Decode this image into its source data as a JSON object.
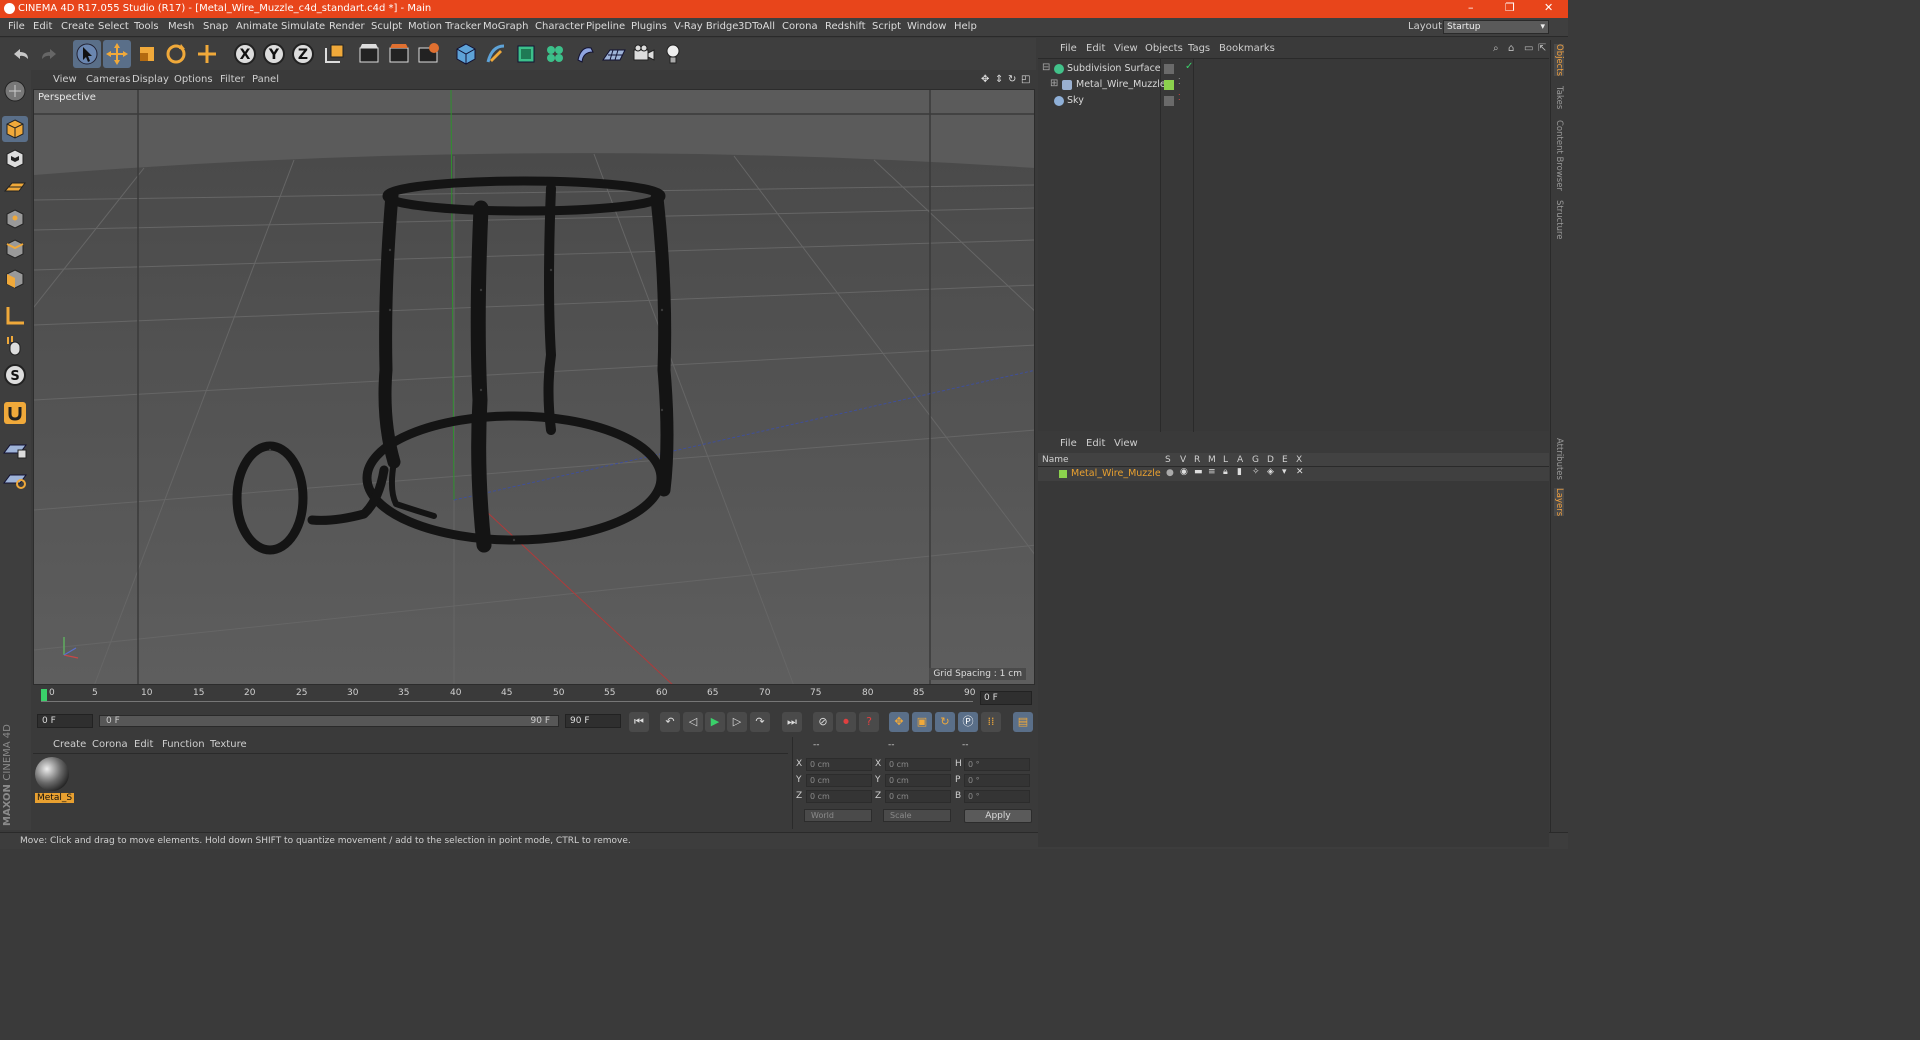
{
  "window": {
    "title": "CINEMA 4D R17.055 Studio (R17) - [Metal_Wire_Muzzle_c4d_standart.c4d *] - Main",
    "minimize": "–",
    "restore": "❐",
    "close": "✕"
  },
  "menu": [
    "File",
    "Edit",
    "Create",
    "Select",
    "Tools",
    "Mesh",
    "Snap",
    "Animate",
    "Simulate",
    "Render",
    "Sculpt",
    "Motion Tracker",
    "MoGraph",
    "Character",
    "Pipeline",
    "Plugins",
    "V-Ray Bridge",
    "3DToAll",
    "Corona",
    "Redshift",
    "Script",
    "Window",
    "Help"
  ],
  "layout": {
    "label": "Layout:",
    "value": "Startup"
  },
  "toolbar_icons": [
    "undo-icon",
    "redo-icon",
    "select-arrow-icon",
    "move-icon",
    "scale-icon",
    "rotate-icon",
    "last-tool-icon",
    "x-axis-icon",
    "y-axis-icon",
    "z-axis-icon",
    "coordinate-system-icon",
    "render-view-icon",
    "render-picture-viewer-icon",
    "render-settings-icon",
    "cube-icon",
    "pen-icon",
    "subdivision-icon",
    "cloner-icon",
    "deformer-icon",
    "floor-icon",
    "camera-icon",
    "light-icon"
  ],
  "viewport": {
    "menu": [
      "View",
      "Cameras",
      "Display",
      "Options",
      "Filter",
      "Panel"
    ],
    "camera_label": "Perspective",
    "grid_spacing": "Grid Spacing : 1 cm"
  },
  "timeline": {
    "ticks": [
      "0",
      "5",
      "10",
      "15",
      "20",
      "25",
      "30",
      "35",
      "40",
      "45",
      "50",
      "55",
      "60",
      "65",
      "70",
      "75",
      "80",
      "85",
      "90"
    ],
    "current_frame": "0 F"
  },
  "transport": {
    "start_field": "0 F",
    "slider_start": "0 F",
    "slider_end": "90 F",
    "end_field": "90 F"
  },
  "material_manager": {
    "menu": [
      "Create",
      "Corona",
      "Edit",
      "Function",
      "Texture"
    ],
    "material_name": "Metal_S"
  },
  "coordinates": {
    "header": [
      "--",
      "--",
      "--"
    ],
    "rows": [
      {
        "axis": "X",
        "pos": "0 cm",
        "size_axis": "X",
        "size": "0 cm",
        "rot_axis": "H",
        "rot": "0 °"
      },
      {
        "axis": "Y",
        "pos": "0 cm",
        "size_axis": "Y",
        "size": "0 cm",
        "rot_axis": "P",
        "rot": "0 °"
      },
      {
        "axis": "Z",
        "pos": "0 cm",
        "size_axis": "Z",
        "size": "0 cm",
        "rot_axis": "B",
        "rot": "0 °"
      }
    ],
    "coord_mode": "World",
    "size_mode": "Scale",
    "apply": "Apply"
  },
  "brand": {
    "maxon": "MAXON",
    "c4d": "CINEMA 4D"
  },
  "object_manager": {
    "menu": [
      "File",
      "Edit",
      "View",
      "Objects",
      "Tags",
      "Bookmarks"
    ],
    "objects": [
      {
        "name": "Subdivision Surface",
        "icon_color": "#42c28a"
      },
      {
        "name": "Metal_Wire_Muzzle",
        "icon_color": "#9ab0d0"
      },
      {
        "name": "Sky",
        "icon_color": "#8fb0d8"
      }
    ]
  },
  "layer_manager": {
    "menu": [
      "File",
      "Edit",
      "View"
    ],
    "columns": [
      "Name",
      "S",
      "V",
      "R",
      "M",
      "L",
      "A",
      "G",
      "D",
      "E",
      "X"
    ],
    "layer_name": "Metal_Wire_Muzzle"
  },
  "right_tabs": [
    "Objects",
    "Takes",
    "Content Browser",
    "Structure",
    "Attributes",
    "Layers"
  ],
  "status": "Move: Click and drag to move elements. Hold down SHIFT to quantize movement / add to the selection in point mode, CTRL to remove."
}
